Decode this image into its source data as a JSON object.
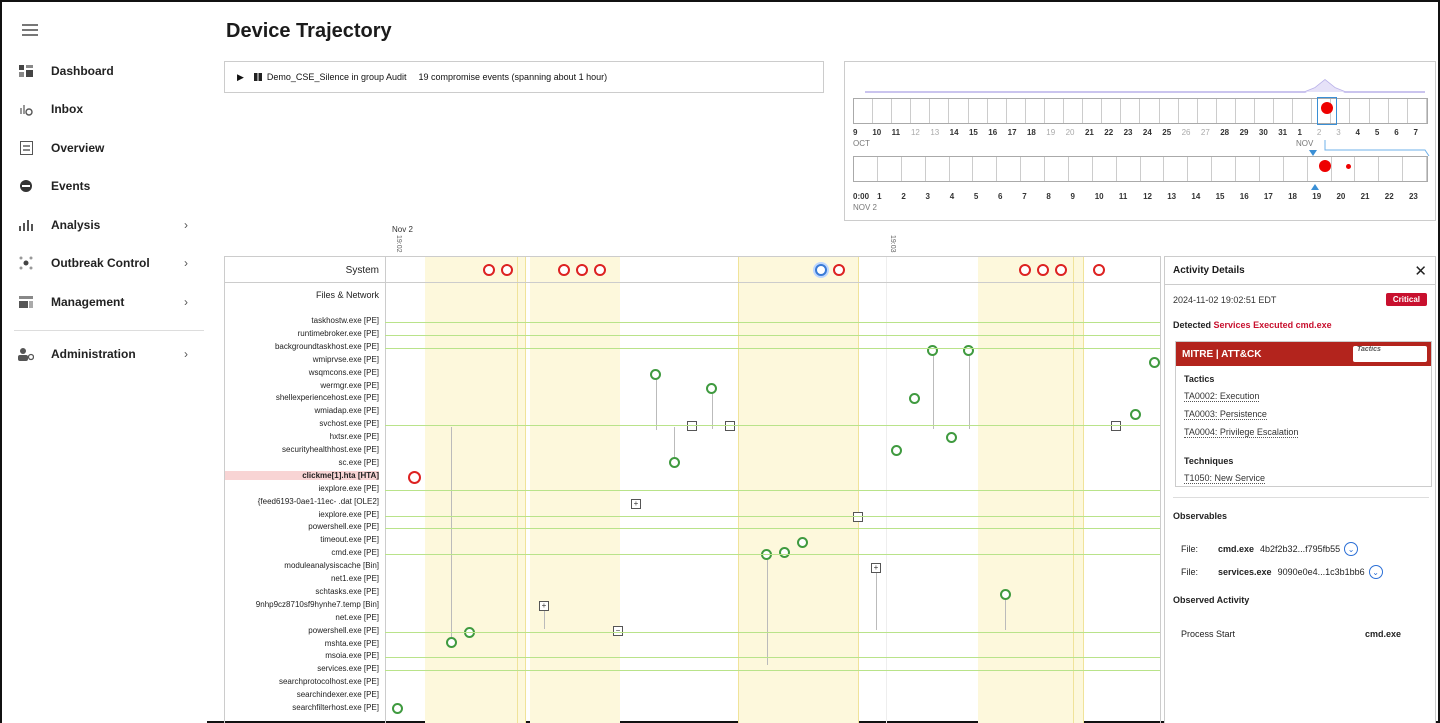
{
  "sidebar": {
    "items": [
      {
        "label": "Dashboard",
        "icon": "dashboard-icon",
        "chevron": false
      },
      {
        "label": "Inbox",
        "icon": "inbox-icon",
        "chevron": false
      },
      {
        "label": "Overview",
        "icon": "overview-icon",
        "chevron": false
      },
      {
        "label": "Events",
        "icon": "events-icon",
        "chevron": false
      },
      {
        "label": "Analysis",
        "icon": "analysis-icon",
        "chevron": true
      },
      {
        "label": "Outbreak Control",
        "icon": "outbreak-icon",
        "chevron": true
      },
      {
        "label": "Management",
        "icon": "management-icon",
        "chevron": true
      },
      {
        "label": "Administration",
        "icon": "admin-icon",
        "chevron": true
      }
    ],
    "chevron": "›"
  },
  "header": {
    "title": "Device Trajectory"
  },
  "group": {
    "name": "Demo_CSE_Silence in group Audit",
    "summary": "19 compromise events (spanning about 1 hour)"
  },
  "navigator": {
    "days": [
      "9",
      "10",
      "11",
      "12",
      "13",
      "14",
      "15",
      "16",
      "17",
      "18",
      "19",
      "20",
      "21",
      "22",
      "23",
      "24",
      "25",
      "26",
      "27",
      "28",
      "29",
      "30",
      "31",
      "1",
      "2",
      "3",
      "4",
      "5",
      "6",
      "7"
    ],
    "dim_days": [
      "12",
      "13",
      "19",
      "20",
      "26",
      "27",
      "2",
      "3"
    ],
    "month_oct": "OCT",
    "month_nov": "NOV",
    "hours": [
      "0:00",
      "1",
      "2",
      "3",
      "4",
      "5",
      "6",
      "7",
      "8",
      "9",
      "10",
      "11",
      "12",
      "13",
      "14",
      "15",
      "16",
      "17",
      "18",
      "19",
      "20",
      "21",
      "22",
      "23"
    ],
    "date_label": "NOV 2"
  },
  "timeline": {
    "date_top": "Nov 2",
    "time_1": "19:02",
    "time_2": "19:03"
  },
  "trajectory": {
    "system_label": "System",
    "files_label": "Files & Network",
    "rows": [
      "taskhostw.exe [PE]",
      "runtimebroker.exe [PE]",
      "backgroundtaskhost.exe [PE]",
      "wmiprvse.exe [PE]",
      "wsqmcons.exe [PE]",
      "wermgr.exe [PE]",
      "shellexperiencehost.exe [PE]",
      "wmiadap.exe [PE]",
      "svchost.exe [PE]",
      "hxtsr.exe [PE]",
      "securityhealthhost.exe [PE]",
      "sc.exe [PE]",
      "clickme[1].hta [HTA]",
      "iexplore.exe [PE]",
      "{feed6193-0ae1-11ec-   .dat [OLE2]",
      "iexplore.exe [PE]",
      "powershell.exe [PE]",
      "timeout.exe [PE]",
      "cmd.exe [PE]",
      "moduleanalysiscache [Bin]",
      "net1.exe [PE]",
      "schtasks.exe [PE]",
      "9nhp9cz8710sf9hynhe7.temp [Bin]",
      "net.exe [PE]",
      "powershell.exe [PE]",
      "mshta.exe [PE]",
      "msoia.exe [PE]",
      "services.exe [PE]",
      "searchprotocolhost.exe [PE]",
      "searchindexer.exe [PE]",
      "searchfilterhost.exe [PE]"
    ]
  },
  "details": {
    "title": "Activity Details",
    "close": "✕",
    "timestamp": "2024-11-02 19:02:51 EDT",
    "severity": "Critical",
    "detected_prefix": "Detected",
    "detected_name": "Services Executed cmd.exe",
    "mitre_brand": "MITRE | ATT&CK",
    "tactics_chip": "Tactics",
    "tactics_heading": "Tactics",
    "tactics": [
      "TA0002: Execution",
      "TA0003: Persistence",
      "TA0004: Privilege Escalation"
    ],
    "techniques_heading": "Techniques",
    "techniques": [
      "T1050: New Service"
    ],
    "observables_heading": "Observables",
    "observables": [
      {
        "label": "File:",
        "name": "cmd.exe",
        "hash": "4b2f2b32...f795fb55"
      },
      {
        "label": "File:",
        "name": "services.exe",
        "hash": "9090e0e4...1c3b1bb6"
      }
    ],
    "activity_heading": "Observed Activity",
    "activity": {
      "key": "Process Start",
      "value": "cmd.exe"
    }
  },
  "colors": {
    "critical": "#c8102e",
    "mitre": "#b3241d",
    "band": "#fdf8dc",
    "event_green": "#3f9a3f",
    "event_red": "#dd2222",
    "link_blue": "#2b6fd6"
  }
}
